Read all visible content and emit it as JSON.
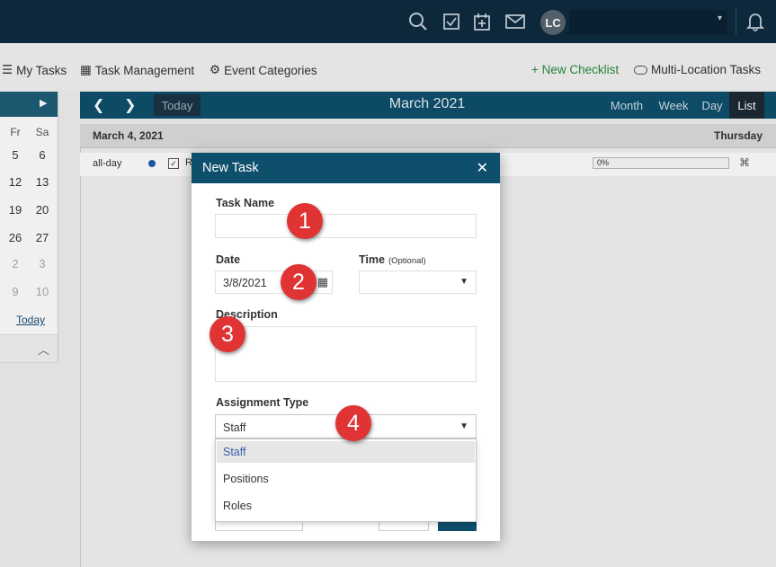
{
  "header": {
    "avatar_initials": "LC",
    "icons": [
      "search-icon",
      "tasks-check-icon",
      "calendar-add-icon",
      "mail-icon",
      "bell-icon"
    ]
  },
  "subnav": {
    "my_tasks": "My Tasks",
    "task_management": "Task Management",
    "event_categories": "Event Categories",
    "new_checklist": "+ New Checklist",
    "multi_location_tasks": "Multi-Location Tasks"
  },
  "minical": {
    "day_headers": [
      "Fr",
      "Sa"
    ],
    "rows": [
      [
        "5",
        "6"
      ],
      [
        "12",
        "13"
      ],
      [
        "19",
        "20"
      ],
      [
        "26",
        "27"
      ],
      [
        "2",
        "3"
      ],
      [
        "9",
        "10"
      ]
    ],
    "today": "Today"
  },
  "calendar": {
    "title": "March 2021",
    "today_button": "Today",
    "views": [
      "Month",
      "Week",
      "Day",
      "List"
    ],
    "active_view": "List",
    "date_label": "March 4, 2021",
    "weekday_label": "Thursday",
    "event": {
      "time": "all-day",
      "title_fragment": "R",
      "progress_text": "0%"
    }
  },
  "modal": {
    "title": "New Task",
    "close": "✕",
    "task_name_label": "Task Name",
    "task_name_value": "",
    "date_label": "Date",
    "date_value": "3/8/2021",
    "time_label": "Time",
    "time_optional": "(Optional)",
    "time_value": "",
    "description_label": "Description",
    "description_value": "",
    "assignment_type_label": "Assignment Type",
    "assignment_type_value": "Staff",
    "assignment_options": [
      "Staff",
      "Positions",
      "Roles"
    ],
    "selected_option": "Staff"
  },
  "markers": [
    "1",
    "2",
    "3",
    "4"
  ],
  "colors": {
    "topbar": "#0e2a3f",
    "accent": "#0e4f6c",
    "marker": "#e03434",
    "green_link": "#2b8a3e"
  }
}
